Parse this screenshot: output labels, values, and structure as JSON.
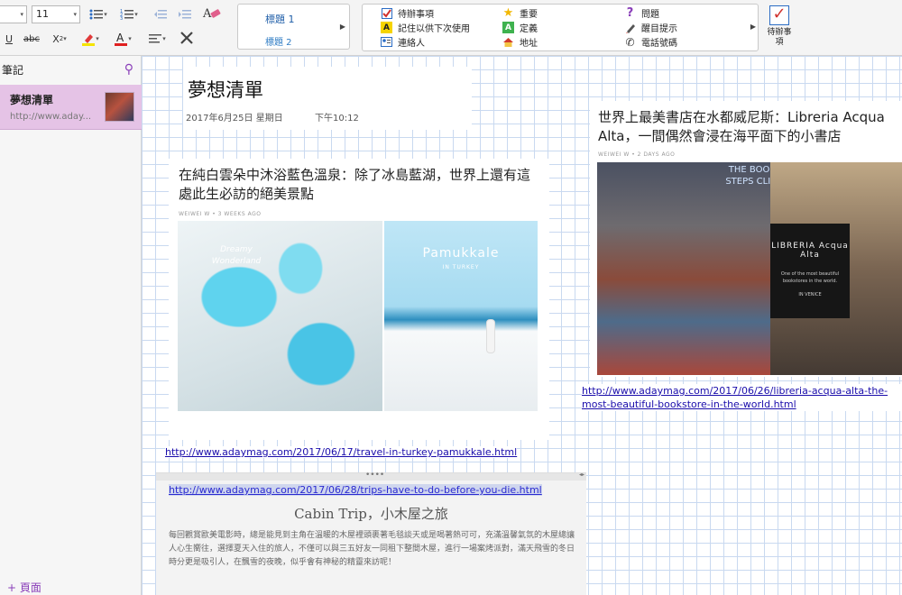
{
  "ribbon": {
    "font_size": "11",
    "styles": {
      "heading1": "標題 1",
      "heading2": "標題 2"
    },
    "tags": [
      {
        "label": "待辦事項",
        "icon": "checkbox-icon"
      },
      {
        "label": "記住以供下次使用",
        "icon": "letter-a-yellow-icon"
      },
      {
        "label": "連絡人",
        "icon": "contact-card-icon"
      },
      {
        "label": "重要",
        "icon": "star-icon"
      },
      {
        "label": "定義",
        "icon": "letter-a-green-icon"
      },
      {
        "label": "地址",
        "icon": "house-icon"
      },
      {
        "label": "問題",
        "icon": "question-icon"
      },
      {
        "label": "醒目提示",
        "icon": "highlighter-icon"
      },
      {
        "label": "電話號碼",
        "icon": "phone-icon"
      }
    ],
    "todo_label": "待辦事項"
  },
  "sidebar": {
    "header": "筆記",
    "notes": [
      {
        "title": "夢想清單",
        "url": "http://www.aday..."
      }
    ],
    "add_page": "+ 頁面"
  },
  "page": {
    "title": "夢想清單",
    "date": "2017年6月25日 星期日",
    "time": "下午10:12",
    "cards": [
      {
        "title": "在純白雲朵中沐浴藍色溫泉：除了冰島藍湖，世界上還有這處此生必訪的絕美景點",
        "meta": "WEIWEI W • 3 WEEKS AGO",
        "img_text_1": "Dreamy Wonderland",
        "img_text_2": "Pamukkale",
        "img_text_3": "IN TURKEY",
        "link": "http://www.adaymag.com/2017/06/17/travel-in-turkey-pamukkale.html"
      },
      {
        "title": "世界上最美書店在水都威尼斯：Libreria Acqua Alta，一間偶然會浸在海平面下的小書店",
        "meta": "WEIWEI W • 2 DAYS AGO",
        "img_text_1": "THE BOOKS STEPS CLIMB",
        "img_text_2": "LIBRERIA Acqua Alta",
        "img_text_3": "One of the most beautiful bookstores in the world.",
        "img_text_4": "IN VENICE",
        "link": "http://www.adaymag.com/2017/06/26/libreria-acqua-alta-the-most-beautiful-bookstore-in-the-world.html"
      }
    ],
    "cabin": {
      "link": "http://www.adaymag.com/2017/06/28/trips-have-to-do-before-you-die.html",
      "title": "Cabin Trip，小木屋之旅",
      "body": "每回觀賞歐美電影時，總是能見到主角在溫暖的木屋裡頭裹著毛毯談天或是喝著熱可可，充滿溫馨氣氛的木屋總讓人心生嚮往，選擇夏天入住的旅人，不僅可以與三五好友一同租下整間木屋，進行一場案烤派對，滿天飛雪的冬日時分更是吸引人，在飄雪的夜晚，似乎會有神秘的精靈來訪呢！"
    }
  },
  "colors": {
    "accent": "#8a3fb9",
    "link": "#1a0dab",
    "selected_note": "#e5c3e6",
    "grid": "#c9d9f0"
  }
}
